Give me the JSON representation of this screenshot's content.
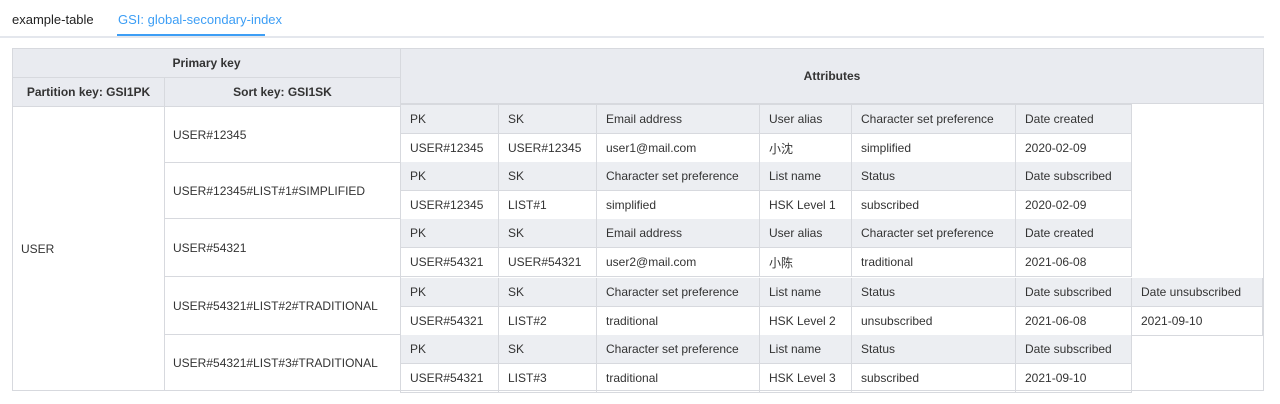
{
  "tabs": [
    {
      "label": "example-table"
    },
    {
      "label": "GSI: global-secondary-index"
    }
  ],
  "headers": {
    "primary_key": "Primary key",
    "partition_key": "Partition key: GSI1PK",
    "sort_key": "Sort key: GSI1SK",
    "attributes": "Attributes"
  },
  "partition_value": "USER",
  "items": [
    {
      "sort_key": "USER#12345",
      "attr_headers": [
        "PK",
        "SK",
        "Email address",
        "User alias",
        "Character set preference",
        "Date created"
      ],
      "attr_values": [
        "USER#12345",
        "USER#12345",
        "user1@mail.com",
        "小沈",
        "simplified",
        "2020-02-09"
      ]
    },
    {
      "sort_key": "USER#12345#LIST#1#SIMPLIFIED",
      "attr_headers": [
        "PK",
        "SK",
        "Character set preference",
        "List name",
        "Status",
        "Date subscribed"
      ],
      "attr_values": [
        "USER#12345",
        "LIST#1",
        "simplified",
        "HSK Level 1",
        "subscribed",
        "2020-02-09"
      ]
    },
    {
      "sort_key": "USER#54321",
      "attr_headers": [
        "PK",
        "SK",
        "Email address",
        "User alias",
        "Character set preference",
        "Date created"
      ],
      "attr_values": [
        "USER#54321",
        "USER#54321",
        "user2@mail.com",
        "小陈",
        "traditional",
        "2021-06-08"
      ]
    },
    {
      "sort_key": "USER#54321#LIST#2#TRADITIONAL",
      "attr_headers": [
        "PK",
        "SK",
        "Character set preference",
        "List name",
        "Status",
        "Date subscribed",
        "Date unsubscribed"
      ],
      "attr_values": [
        "USER#54321",
        "LIST#2",
        "traditional",
        "HSK Level 2",
        "unsubscribed",
        "2021-06-08",
        "2021-09-10"
      ]
    },
    {
      "sort_key": "USER#54321#LIST#3#TRADITIONAL",
      "attr_headers": [
        "PK",
        "SK",
        "Character set preference",
        "List name",
        "Status",
        "Date subscribed"
      ],
      "attr_values": [
        "USER#54321",
        "LIST#3",
        "traditional",
        "HSK Level 3",
        "subscribed",
        "2021-09-10"
      ]
    }
  ]
}
